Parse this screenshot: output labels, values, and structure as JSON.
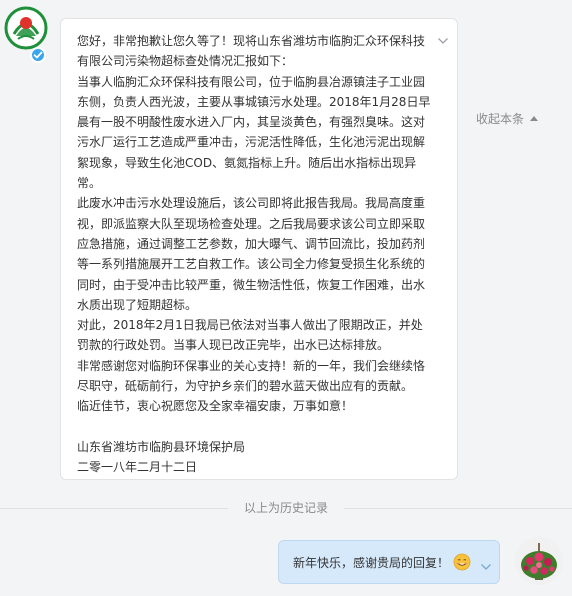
{
  "message_left": {
    "paragraphs": [
      "您好，非常抱歉让您久等了！现将山东省潍坊市临朐汇众环保科技有限公司污染物超标查处情况汇报如下：",
      "当事人临朐汇众环保科技有限公司，位于临朐县冶源镇洼子工业园东侧，负责人西光波，主要从事城镇污水处理。2018年1月28日早晨有一股不明酸性废水进入厂内，其呈淡黄色，有强烈臭味。这对污水厂运行工艺造成严重冲击，污泥活性降低，生化池污泥出现解絮现象，导致生化池COD、氨氮指标上升。随后出水指标出现异常。",
      "此废水冲击污水处理设施后，该公司即将此报告我局。我局高度重视，即派监察大队至现场检查处理。之后我局要求该公司立即采取应急措施，通过调整工艺参数，加大曝气、调节回流比，投加药剂等一系列措施展开工艺自救工作。该公司全力修复受损生化系统的同时，由于受冲击比较严重，微生物活性低，恢复工作困难，出水水质出现了短期超标。",
      "对此，2018年2月1日我局已依法对当事人做出了限期改正，并处罚款的行政处罚。当事人现已改正完毕，出水已达标排放。",
      "非常感谢您对临朐环保事业的关心支持！新的一年，我们会继续恪尽职守，砥砺前行，为守护乡亲们的碧水蓝天做出应有的贡献。",
      "临近佳节，衷心祝愿您及全家幸福安康，万事如意！"
    ],
    "signature_org": "山东省潍坊市临朐县环境保护局",
    "signature_date": "二零一八年二月十二日"
  },
  "collapse_label": "收起本条",
  "history_label": "以上为历史记录",
  "message_right": {
    "text": "新年快乐，感谢贵局的回复！"
  },
  "icons": {
    "left_avatar": "environmental-protection-emblem-icon",
    "verify": "verified-badge-icon",
    "chevron": "chevron-down-icon",
    "emoji": "smiling-face-icon",
    "right_avatar": "flower-pot-avatar-icon"
  },
  "colors": {
    "verify_badge": "#3aa5e8",
    "right_bubble": "#d6e9fb",
    "emblem_green": "#1f8f3a",
    "emblem_red": "#e0322b"
  }
}
